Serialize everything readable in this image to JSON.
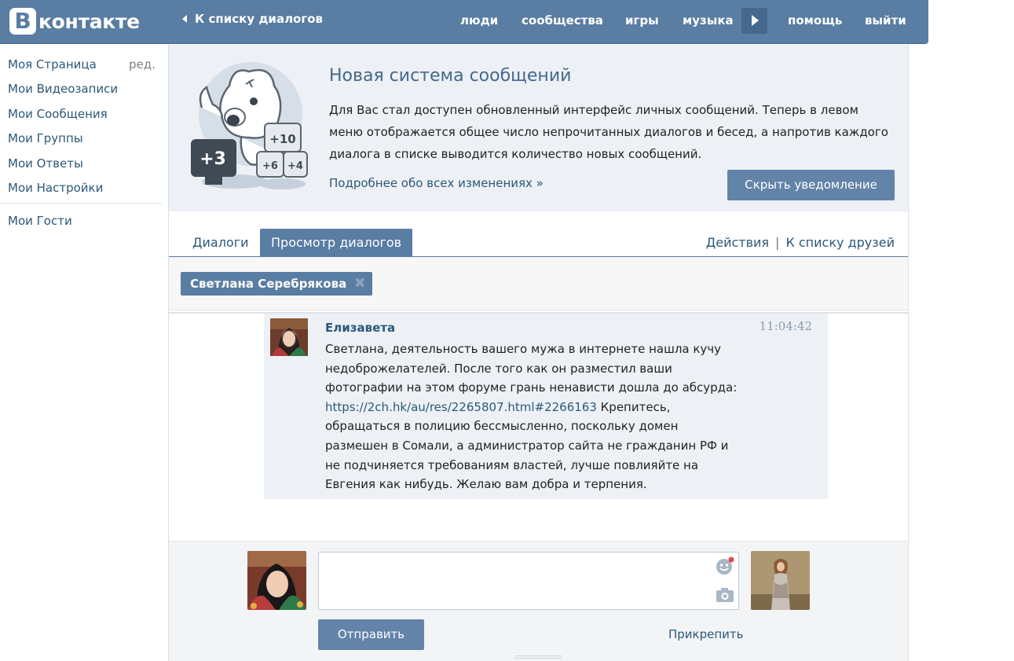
{
  "header": {
    "logo_letter": "В",
    "logo_text": "контакте",
    "back_label": "К списку диалогов",
    "nav": [
      "люди",
      "сообщества",
      "игры",
      "музыка",
      "помощь",
      "выйти"
    ]
  },
  "left_menu": {
    "items": [
      "Моя Страница",
      "Мои Видеозаписи",
      "Мои Сообщения",
      "Мои Группы",
      "Мои Ответы",
      "Мои Настройки"
    ],
    "edit_label": "ред.",
    "extra": "Мои Гости"
  },
  "notice": {
    "title": "Новая система сообщений",
    "text": "Для Вас стал доступен обновленный интерфейс личных сообщений. Теперь в левом меню отображается общее число непрочитанных диалогов и бесед, а напротив каждого диалога в списке выводится количество новых сообщений.",
    "more_link": "Подробнее обо всех изменениях »",
    "hide_button": "Скрыть уведомление",
    "mascot_badges": [
      "+3",
      "+10",
      "+6",
      "+4"
    ]
  },
  "tabs": {
    "dialogs": "Диалоги",
    "view": "Просмотр диалогов",
    "actions": "Действия",
    "separator": "|",
    "friends": "К списку друзей"
  },
  "chip": {
    "name": "Светлана Серебрякова",
    "remove": "✖"
  },
  "message": {
    "author": "Елизавета",
    "time": "11:04:42",
    "text_before": "Светлана, деятельность вашего мужа в интернете нашла кучу недоброжелателей. После того как он разместил ваши фотографии на этом форуме грань ненависти дошла до абсурда: ",
    "link": "https://2ch.hk/au/res/2265807.html#2266163",
    "text_after": " Крепитесь, обращаться в полицию бессмысленно, поскольку домен размешен в Сомали, а администратор сайта не гражданин РФ и не подчиняется требованиям властей, лучше повлияйте на Евгения как нибудь. Желаю вам добра и терпения."
  },
  "composer": {
    "send": "Отправить",
    "attach": "Прикрепить"
  },
  "colors": {
    "brand": "#597da3",
    "link": "#2b587a",
    "notice_bg": "#edf0f4",
    "message_bg": "#edf1f5"
  }
}
